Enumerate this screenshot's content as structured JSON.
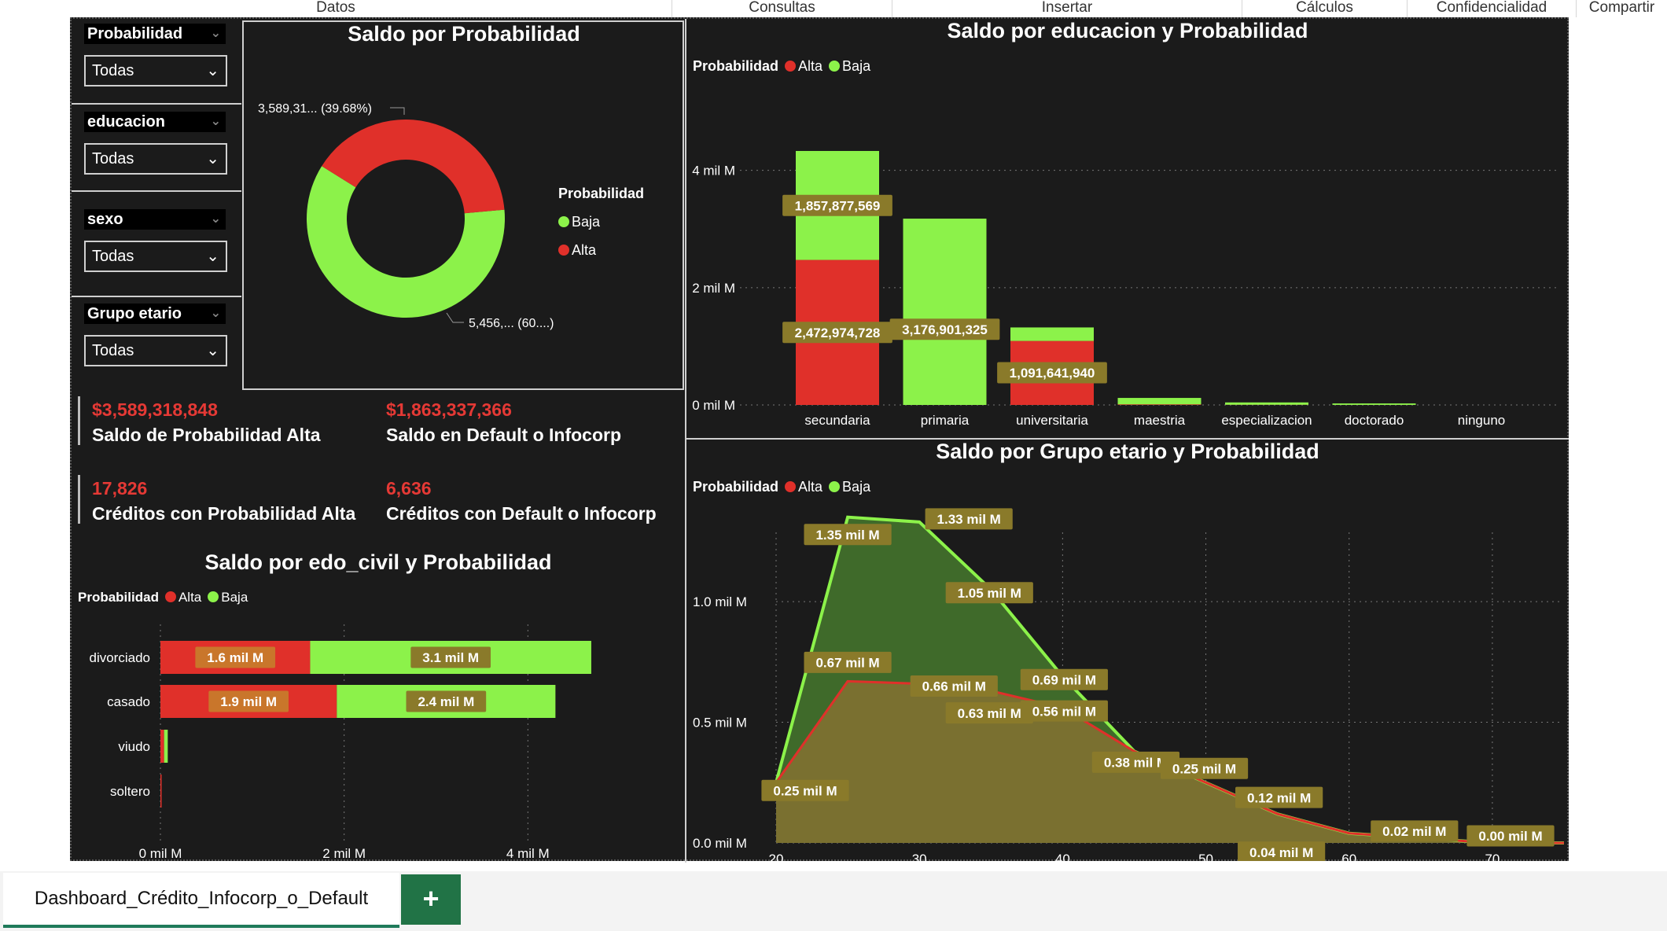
{
  "ribbon": {
    "tabs": [
      "Datos",
      "Consultas",
      "Insertar",
      "Cálculos",
      "Confidencialidad",
      "Compartir"
    ]
  },
  "slicers": [
    {
      "title": "Probabilidad",
      "value": "Todas"
    },
    {
      "title": "educacion",
      "value": "Todas"
    },
    {
      "title": "sexo",
      "value": "Todas"
    },
    {
      "title": "Grupo etario",
      "value": "Todas"
    }
  ],
  "colors": {
    "alta": "#e0302a",
    "baja": "#8cf24a",
    "label_bg": "#8a7a2a",
    "label_bg_red": "#c9762b"
  },
  "legend": {
    "title": "Probabilidad",
    "alta": "Alta",
    "baja": "Baja"
  },
  "kpis": [
    {
      "value": "$3,589,318,848",
      "label": "Saldo de Probabilidad Alta"
    },
    {
      "value": "$1,863,337,366",
      "label": "Saldo en Default o Infocorp"
    },
    {
      "value": "17,826",
      "label": "Créditos con Probabilidad Alta"
    },
    {
      "value": "6,636",
      "label": "Créditos con Default o Infocorp"
    }
  ],
  "sheet_tab": "Dashboard_Crédito_Infocorp_o_Default",
  "add_sheet": "+",
  "chart_data": [
    {
      "type": "pie",
      "title": "Saldo por Probabilidad",
      "legend_title": "Probabilidad",
      "categories": [
        "Baja",
        "Alta"
      ],
      "values": [
        60.32,
        39.68
      ],
      "data_labels": [
        "5,456,... (60....)",
        "3,589,31... (39.68%)"
      ],
      "legend_position": "right"
    },
    {
      "type": "bar",
      "title": "Saldo por educacion y Probabilidad",
      "categories": [
        "secundaria",
        "primaria",
        "universitaria",
        "maestria",
        "especializacion",
        "doctorado",
        "ninguno"
      ],
      "series": [
        {
          "name": "Alta",
          "values": [
            2472974728,
            0,
            1091641940,
            10000000,
            3000000,
            1000000,
            0
          ]
        },
        {
          "name": "Baja",
          "values": [
            1857877569,
            3176901325,
            230000000,
            110000000,
            40000000,
            25000000,
            0
          ]
        }
      ],
      "data_labels": {
        "Alta": [
          "2,472,974,728",
          "",
          "1,091,641,940",
          "",
          "",
          "",
          ""
        ],
        "Baja": [
          "1,857,877,569",
          "3,176,901,325",
          "",
          "",
          "",
          "",
          ""
        ]
      },
      "yticks": [
        "0 mil M",
        "2 mil M",
        "4 mil M"
      ],
      "ylim": [
        0,
        4800000000
      ],
      "legend_position": "top-left",
      "grid": true
    },
    {
      "type": "bar",
      "orientation": "horizontal",
      "title": "Saldo por edo_civil y Probabilidad",
      "categories": [
        "divorciado",
        "casado",
        "viudo",
        "soltero"
      ],
      "series": [
        {
          "name": "Alta",
          "values": [
            1.63,
            1.92,
            0.04,
            0.005
          ]
        },
        {
          "name": "Baja",
          "values": [
            3.06,
            2.38,
            0.04,
            0.0
          ]
        }
      ],
      "data_labels": {
        "Alta": [
          "1.6 mil M",
          "1.9 mil M",
          "",
          ""
        ],
        "Baja": [
          "3.1 mil M",
          "2.4 mil M",
          "",
          ""
        ]
      },
      "xticks": [
        "0 mil M",
        "2 mil M",
        "4 mil M"
      ],
      "xlim": [
        0,
        5.05
      ],
      "legend_position": "top-left",
      "grid": true
    },
    {
      "type": "area",
      "title": "Saldo por Grupo etario y Probabilidad",
      "x": [
        20,
        25,
        30,
        35,
        40,
        45,
        50,
        55,
        60,
        65,
        70,
        75
      ],
      "series": [
        {
          "name": "Baja",
          "values": [
            0.25,
            1.35,
            1.33,
            1.05,
            0.69,
            0.38,
            0.25,
            0.12,
            0.04,
            0.02,
            0.0,
            0.0
          ]
        },
        {
          "name": "Alta",
          "values": [
            0.25,
            0.67,
            0.66,
            0.63,
            0.56,
            0.38,
            0.25,
            0.12,
            0.04,
            0.02,
            0.0,
            0.0
          ]
        }
      ],
      "data_labels": [
        "0.25 mil M",
        "1.35 mil M",
        "1.33 mil M",
        "1.05 mil M",
        "0.69 mil M",
        "0.67 mil M",
        "0.66 mil M",
        "0.63 mil M",
        "0.56 mil M",
        "0.38 mil M",
        "0.25 mil M",
        "0.12 mil M",
        "0.04 mil M",
        "0.02 mil M",
        "0.00 mil M"
      ],
      "xticks": [
        "20",
        "30",
        "40",
        "50",
        "60",
        "70"
      ],
      "yticks": [
        "0.0 mil M",
        "0.5 mil M",
        "1.0 mil M"
      ],
      "ylim": [
        0,
        1.45
      ],
      "legend_position": "top-left",
      "grid": true
    }
  ]
}
